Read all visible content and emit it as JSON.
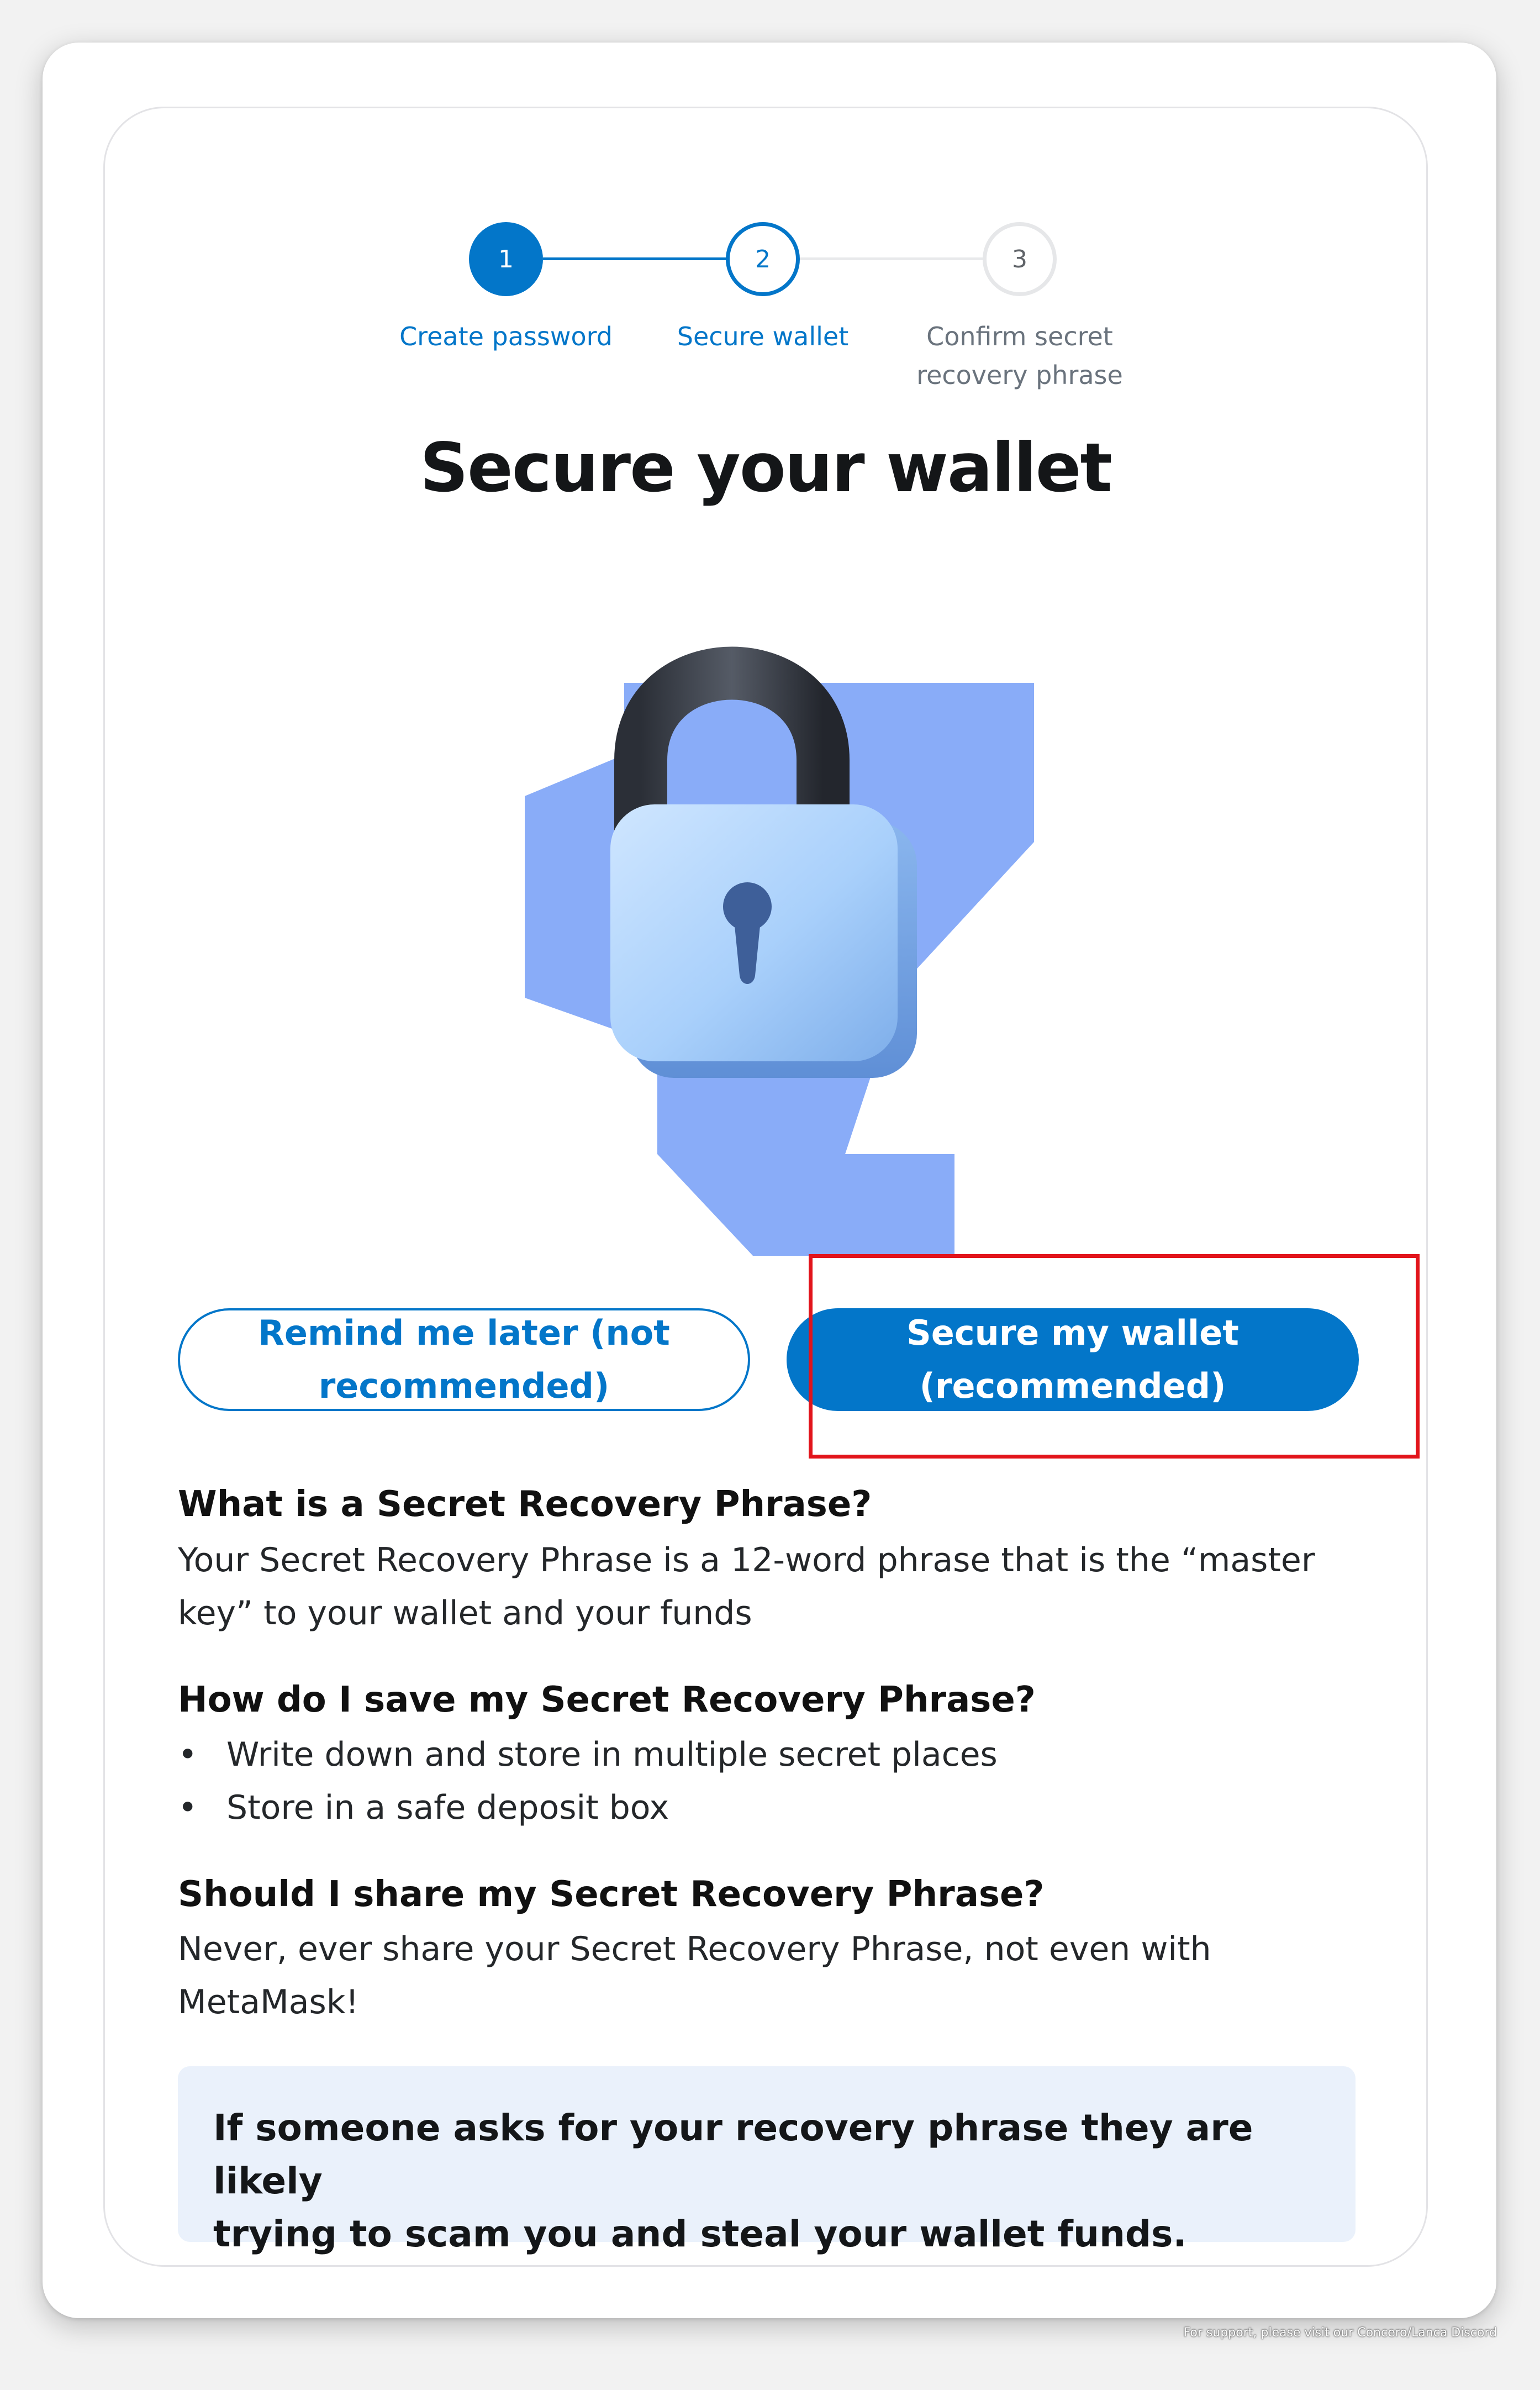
{
  "stepper": {
    "steps": [
      {
        "number": "1",
        "label": "Create password"
      },
      {
        "number": "2",
        "label": "Secure wallet"
      },
      {
        "number": "3",
        "label_line1": "Confirm secret",
        "label_line2": "recovery phrase"
      }
    ]
  },
  "title": "Secure your wallet",
  "illustration": {
    "icon": "padlock-icon"
  },
  "buttons": {
    "remind_later_line1": "Remind me later (not",
    "remind_later_line2": "recommended)",
    "secure_line1": "Secure my wallet",
    "secure_line2": "(recommended)"
  },
  "info": {
    "q1": "What is a Secret Recovery Phrase?",
    "a1_line1": "Your Secret Recovery Phrase is a 12-word phrase that is the “master",
    "a1_line2": "key” to your wallet and your funds",
    "q2": "How do I save my Secret Recovery Phrase?",
    "tips": [
      "Write down and store in multiple secret places",
      "Store in a safe deposit box"
    ],
    "q3": "Should I share my Secret Recovery Phrase?",
    "a3_line1": "Never, ever share your Secret Recovery Phrase, not even with",
    "a3_line2": "MetaMask!"
  },
  "warning": {
    "line1": "If someone asks for your recovery phrase they are likely",
    "line2": "trying to scam you and steal your wallet funds."
  },
  "footer": "For support, please visit our Concero/Lanca Discord",
  "colors": {
    "primary": "#0376c9",
    "highlight": "#e2141b",
    "warning_bg": "#eaf1fb",
    "inactive": "#d6d9dc"
  }
}
